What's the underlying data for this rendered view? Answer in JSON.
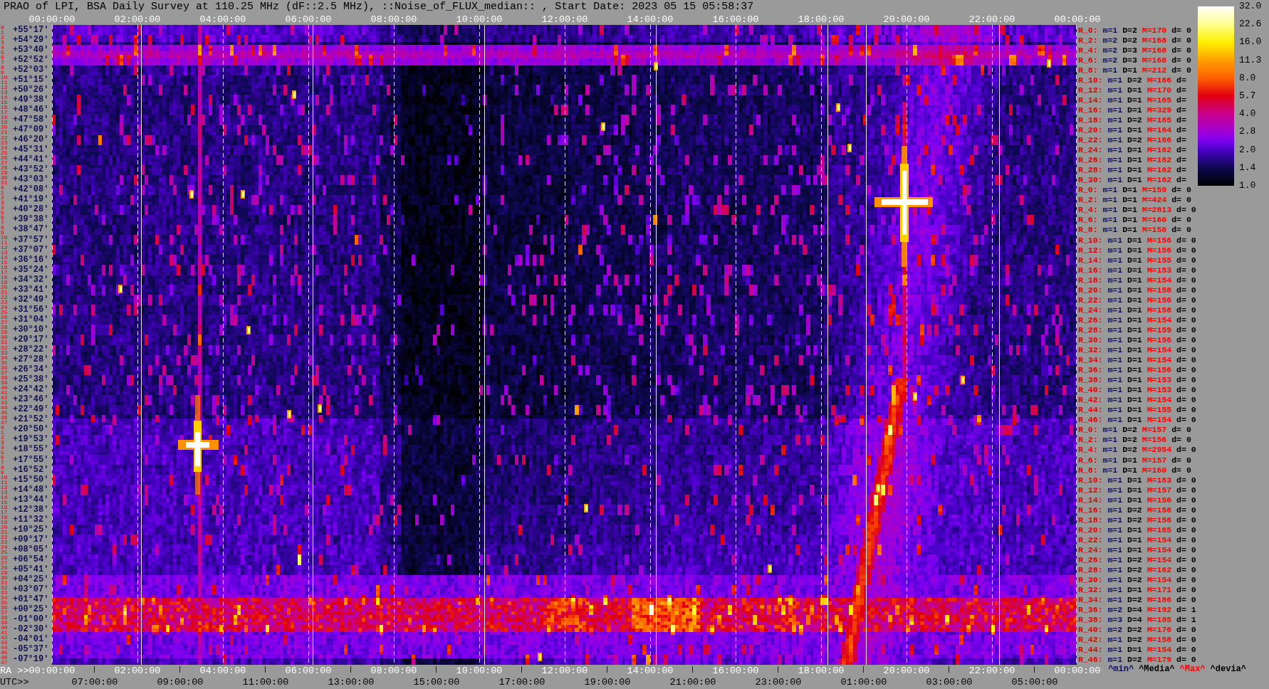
{
  "title": "PRAO of LPI, BSA Daily Survey at 110.25 MHz (dF::2.5 MHz), ::Noise_of_FLUX_median:: , Start Date: 2023 05 15 05:58:37",
  "ra_axis_top": {
    "ticks": [
      "00:00:00",
      "02:00:00",
      "04:00:00",
      "06:00:00",
      "08:00:00",
      "10:00:00",
      "12:00:00",
      "14:00:00",
      "16:00:00",
      "18:00:00",
      "20:00:00",
      "22:00:00",
      "00:00:00"
    ]
  },
  "declination_rows": [
    {
      "indices": [
        "0",
        "1"
      ],
      "label": "+55°17'"
    },
    {
      "indices": [
        "2",
        "3"
      ],
      "label": "+54°29'"
    },
    {
      "indices": [
        "4",
        "5"
      ],
      "label": "+53°40'"
    },
    {
      "indices": [
        "6",
        "7"
      ],
      "label": "+52°52'"
    },
    {
      "indices": [
        "8",
        "9"
      ],
      "label": "+52°03'"
    },
    {
      "indices": [
        "10",
        "11"
      ],
      "label": "+51°15'"
    },
    {
      "indices": [
        "12",
        "13"
      ],
      "label": "+50°26'"
    },
    {
      "indices": [
        "14",
        "15"
      ],
      "label": "+49°38'"
    },
    {
      "indices": [
        "16",
        "17"
      ],
      "label": "+48°46'"
    },
    {
      "indices": [
        "18",
        "19"
      ],
      "label": "+47°58'"
    },
    {
      "indices": [
        "20",
        "21"
      ],
      "label": "+47°09'"
    },
    {
      "indices": [
        "22",
        "23"
      ],
      "label": "+46°20'"
    },
    {
      "indices": [
        "24",
        "25"
      ],
      "label": "+45°31'"
    },
    {
      "indices": [
        "26",
        "27"
      ],
      "label": "+44°41'"
    },
    {
      "indices": [
        "28",
        "29"
      ],
      "label": "+43°52'"
    },
    {
      "indices": [
        "30",
        "31"
      ],
      "label": "+43°03'"
    },
    {
      "indices": [
        "0",
        "1"
      ],
      "label": "+42°08'"
    },
    {
      "indices": [
        "2",
        "3"
      ],
      "label": "+41°19'"
    },
    {
      "indices": [
        "4",
        "5"
      ],
      "label": "+40°28'"
    },
    {
      "indices": [
        "6",
        "7"
      ],
      "label": "+39°38'"
    },
    {
      "indices": [
        "8",
        "9"
      ],
      "label": "+38°47'"
    },
    {
      "indices": [
        "10",
        "11"
      ],
      "label": "+37°57'"
    },
    {
      "indices": [
        "12",
        "13"
      ],
      "label": "+37°07'"
    },
    {
      "indices": [
        "14",
        "15"
      ],
      "label": "+36°16'"
    },
    {
      "indices": [
        "16",
        "17"
      ],
      "label": "+35°24'"
    },
    {
      "indices": [
        "18",
        "19"
      ],
      "label": "+34°32'"
    },
    {
      "indices": [
        "20",
        "21"
      ],
      "label": "+33°41'"
    },
    {
      "indices": [
        "22",
        "23"
      ],
      "label": "+32°49'"
    },
    {
      "indices": [
        "24",
        "25"
      ],
      "label": "+31°56'"
    },
    {
      "indices": [
        "26",
        "27"
      ],
      "label": "+31°04'"
    },
    {
      "indices": [
        "28",
        "29"
      ],
      "label": "+30°10'"
    },
    {
      "indices": [
        "30",
        "31"
      ],
      "label": "+29°17'"
    },
    {
      "indices": [
        "32",
        "33"
      ],
      "label": "+28°22'"
    },
    {
      "indices": [
        "34",
        "35"
      ],
      "label": "+27°28'"
    },
    {
      "indices": [
        "36",
        "37"
      ],
      "label": "+26°34'"
    },
    {
      "indices": [
        "38",
        "39"
      ],
      "label": "+25°38'"
    },
    {
      "indices": [
        "40",
        "41"
      ],
      "label": "+24°42'"
    },
    {
      "indices": [
        "42",
        "43"
      ],
      "label": "+23°46'"
    },
    {
      "indices": [
        "44",
        "45"
      ],
      "label": "+22°49'"
    },
    {
      "indices": [
        "46",
        "47"
      ],
      "label": "+21°52'"
    },
    {
      "indices": [
        "0",
        "1"
      ],
      "label": "+20°50'"
    },
    {
      "indices": [
        "2",
        "3"
      ],
      "label": "+19°53'"
    },
    {
      "indices": [
        "4",
        "5"
      ],
      "label": "+18°55'"
    },
    {
      "indices": [
        "6",
        "7"
      ],
      "label": "+17°55'"
    },
    {
      "indices": [
        "8",
        "9"
      ],
      "label": "+16°52'"
    },
    {
      "indices": [
        "10",
        "11"
      ],
      "label": "+15°50'"
    },
    {
      "indices": [
        "12",
        "13"
      ],
      "label": "+14°48'"
    },
    {
      "indices": [
        "14",
        "15"
      ],
      "label": "+13°44'"
    },
    {
      "indices": [
        "16",
        "17"
      ],
      "label": "+12°38'"
    },
    {
      "indices": [
        "18",
        "19"
      ],
      "label": "+11°32'"
    },
    {
      "indices": [
        "20",
        "21"
      ],
      "label": "+10°25'"
    },
    {
      "indices": [
        "22",
        "23"
      ],
      "label": "+09°17'"
    },
    {
      "indices": [
        "24",
        "25"
      ],
      "label": "+08°05'"
    },
    {
      "indices": [
        "26",
        "27"
      ],
      "label": "+06°54'"
    },
    {
      "indices": [
        "28",
        "29"
      ],
      "label": "+05°41'"
    },
    {
      "indices": [
        "30",
        "31"
      ],
      "label": "+04°25'"
    },
    {
      "indices": [
        "32",
        "33"
      ],
      "label": "+03°07'"
    },
    {
      "indices": [
        "34",
        "35"
      ],
      "label": "+01°47'"
    },
    {
      "indices": [
        "36",
        "37"
      ],
      "label": "+00°25'"
    },
    {
      "indices": [
        "38",
        "39"
      ],
      "label": "-01°00'"
    },
    {
      "indices": [
        "40",
        "41"
      ],
      "label": "-02°30'"
    },
    {
      "indices": [
        "42",
        "43"
      ],
      "label": "-04°01'"
    },
    {
      "indices": [
        "44",
        "45"
      ],
      "label": "-05°37'"
    },
    {
      "indices": [
        "46",
        "47"
      ],
      "label": "-07°19'"
    }
  ],
  "row_stats": [
    {
      "label": "R_0:",
      "min": "m=1",
      "disp": "D=2",
      "max": "M=170",
      "dev": "d= 0"
    },
    {
      "label": "R_2:",
      "min": "m=2",
      "disp": "D=2",
      "max": "M=168",
      "dev": "d= 0"
    },
    {
      "label": "R_4:",
      "min": "m=2",
      "disp": "D=3",
      "max": "M=168",
      "dev": "d= 0"
    },
    {
      "label": "R_6:",
      "min": "m=2",
      "disp": "D=3",
      "max": "M=168",
      "dev": "d= 0"
    },
    {
      "label": "R_8:",
      "min": "m=1",
      "disp": "D=1",
      "max": "M=212",
      "dev": "d= 0"
    },
    {
      "label": "R_10:",
      "min": "m=1",
      "disp": "D=2",
      "max": "M=166",
      "dev": "d="
    },
    {
      "label": "R_12:",
      "min": "m=1",
      "disp": "D=1",
      "max": "M=170",
      "dev": "d="
    },
    {
      "label": "R_14:",
      "min": "m=1",
      "disp": "D=1",
      "max": "M=165",
      "dev": "d="
    },
    {
      "label": "R_16:",
      "min": "m=1",
      "disp": "D=1",
      "max": "M=329",
      "dev": "d="
    },
    {
      "label": "R_18:",
      "min": "m=1",
      "disp": "D=2",
      "max": "M=165",
      "dev": "d="
    },
    {
      "label": "R_20:",
      "min": "m=1",
      "disp": "D=1",
      "max": "M=164",
      "dev": "d="
    },
    {
      "label": "R_22:",
      "min": "m=1",
      "disp": "D=2",
      "max": "M=166",
      "dev": "d="
    },
    {
      "label": "R_24:",
      "min": "m=1",
      "disp": "D=1",
      "max": "M=162",
      "dev": "d="
    },
    {
      "label": "R_26:",
      "min": "m=1",
      "disp": "D=1",
      "max": "M=162",
      "dev": "d="
    },
    {
      "label": "R_28:",
      "min": "m=1",
      "disp": "D=1",
      "max": "M=162",
      "dev": "d="
    },
    {
      "label": "R_30:",
      "min": "m=1",
      "disp": "D=1",
      "max": "M=162",
      "dev": "d="
    },
    {
      "label": "R_0:",
      "min": "m=1",
      "disp": "D=1",
      "max": "M=159",
      "dev": "d= 0"
    },
    {
      "label": "R_2:",
      "min": "m=1",
      "disp": "D=1",
      "max": "M=424",
      "dev": "d= 0"
    },
    {
      "label": "R_4:",
      "min": "m=1",
      "disp": "D=1",
      "max": "M=2813",
      "dev": "d= 0"
    },
    {
      "label": "R_6:",
      "min": "m=1",
      "disp": "D=1",
      "max": "M=160",
      "dev": "d= 0"
    },
    {
      "label": "R_8:",
      "min": "m=1",
      "disp": "D=1",
      "max": "M=158",
      "dev": "d= 0"
    },
    {
      "label": "R_10:",
      "min": "m=1",
      "disp": "D=1",
      "max": "M=156",
      "dev": "d= 0"
    },
    {
      "label": "R_12:",
      "min": "m=1",
      "disp": "D=1",
      "max": "M=156",
      "dev": "d= 0"
    },
    {
      "label": "R_14:",
      "min": "m=1",
      "disp": "D=1",
      "max": "M=155",
      "dev": "d= 0"
    },
    {
      "label": "R_16:",
      "min": "m=1",
      "disp": "D=1",
      "max": "M=153",
      "dev": "d= 0"
    },
    {
      "label": "R_18:",
      "min": "m=1",
      "disp": "D=1",
      "max": "M=154",
      "dev": "d= 0"
    },
    {
      "label": "R_20:",
      "min": "m=1",
      "disp": "D=1",
      "max": "M=158",
      "dev": "d= 0"
    },
    {
      "label": "R_22:",
      "min": "m=1",
      "disp": "D=1",
      "max": "M=156",
      "dev": "d= 0"
    },
    {
      "label": "R_24:",
      "min": "m=1",
      "disp": "D=1",
      "max": "M=158",
      "dev": "d= 0"
    },
    {
      "label": "R_26:",
      "min": "m=1",
      "disp": "D=1",
      "max": "M=154",
      "dev": "d= 0"
    },
    {
      "label": "R_28:",
      "min": "m=1",
      "disp": "D=1",
      "max": "M=159",
      "dev": "d= 0"
    },
    {
      "label": "R_30:",
      "min": "m=1",
      "disp": "D=1",
      "max": "M=156",
      "dev": "d= 0"
    },
    {
      "label": "R_32:",
      "min": "m=1",
      "disp": "D=1",
      "max": "M=154",
      "dev": "d= 0"
    },
    {
      "label": "R_34:",
      "min": "m=1",
      "disp": "D=1",
      "max": "M=154",
      "dev": "d= 0"
    },
    {
      "label": "R_36:",
      "min": "m=1",
      "disp": "D=1",
      "max": "M=156",
      "dev": "d= 0"
    },
    {
      "label": "R_38:",
      "min": "m=1",
      "disp": "D=1",
      "max": "M=153",
      "dev": "d= 0"
    },
    {
      "label": "R_40:",
      "min": "m=1",
      "disp": "D=1",
      "max": "M=153",
      "dev": "d= 0"
    },
    {
      "label": "R_42:",
      "min": "m=1",
      "disp": "D=1",
      "max": "M=154",
      "dev": "d= 0"
    },
    {
      "label": "R_44:",
      "min": "m=1",
      "disp": "D=1",
      "max": "M=155",
      "dev": "d= 0"
    },
    {
      "label": "R_46:",
      "min": "m=1",
      "disp": "D=1",
      "max": "M=154",
      "dev": "d= 0"
    },
    {
      "label": "R_0:",
      "min": "m=1",
      "disp": "D=2",
      "max": "M=157",
      "dev": "d= 0"
    },
    {
      "label": "R_2:",
      "min": "m=1",
      "disp": "D=2",
      "max": "M=156",
      "dev": "d= 0"
    },
    {
      "label": "R_4:",
      "min": "m=1",
      "disp": "D=2",
      "max": "M=2954",
      "dev": "d= 0"
    },
    {
      "label": "R_6:",
      "min": "m=1",
      "disp": "D=1",
      "max": "M=157",
      "dev": "d= 0"
    },
    {
      "label": "R_8:",
      "min": "m=1",
      "disp": "D=1",
      "max": "M=160",
      "dev": "d= 0"
    },
    {
      "label": "R_10:",
      "min": "m=1",
      "disp": "D=1",
      "max": "M=163",
      "dev": "d= 0"
    },
    {
      "label": "R_12:",
      "min": "m=1",
      "disp": "D=1",
      "max": "M=157",
      "dev": "d= 0"
    },
    {
      "label": "R_14:",
      "min": "m=1",
      "disp": "D=1",
      "max": "M=156",
      "dev": "d= 0"
    },
    {
      "label": "R_16:",
      "min": "m=1",
      "disp": "D=2",
      "max": "M=156",
      "dev": "d= 0"
    },
    {
      "label": "R_18:",
      "min": "m=1",
      "disp": "D=2",
      "max": "M=156",
      "dev": "d= 0"
    },
    {
      "label": "R_20:",
      "min": "m=1",
      "disp": "D=1",
      "max": "M=165",
      "dev": "d= 0"
    },
    {
      "label": "R_22:",
      "min": "m=1",
      "disp": "D=1",
      "max": "M=154",
      "dev": "d= 0"
    },
    {
      "label": "R_24:",
      "min": "m=1",
      "disp": "D=1",
      "max": "M=154",
      "dev": "d= 0"
    },
    {
      "label": "R_26:",
      "min": "m=1",
      "disp": "D=2",
      "max": "M=154",
      "dev": "d= 0"
    },
    {
      "label": "R_28:",
      "min": "m=1",
      "disp": "D=2",
      "max": "M=162",
      "dev": "d= 0"
    },
    {
      "label": "R_30:",
      "min": "m=1",
      "disp": "D=2",
      "max": "M=154",
      "dev": "d= 0"
    },
    {
      "label": "R_32:",
      "min": "m=1",
      "disp": "D=1",
      "max": "M=171",
      "dev": "d= 0"
    },
    {
      "label": "R_34:",
      "min": "m=1",
      "disp": "D=2",
      "max": "M=186",
      "dev": "d= 0"
    },
    {
      "label": "R_36:",
      "min": "m=2",
      "disp": "D=4",
      "max": "M=192",
      "dev": "d= 1"
    },
    {
      "label": "R_38:",
      "min": "m=3",
      "disp": "D=4",
      "max": "M=185",
      "dev": "d= 1"
    },
    {
      "label": "R_40:",
      "min": "m=2",
      "disp": "D=2",
      "max": "M=176",
      "dev": "d= 0"
    },
    {
      "label": "R_42:",
      "min": "m=1",
      "disp": "D=2",
      "max": "M=158",
      "dev": "d= 0"
    },
    {
      "label": "R_44:",
      "min": "m=1",
      "disp": "D=1",
      "max": "M=154",
      "dev": "d= 0"
    },
    {
      "label": "R_46:",
      "min": "m=1",
      "disp": "D=2",
      "max": "M=179",
      "dev": "d= 0"
    }
  ],
  "color_scale": {
    "ticks": [
      "32.0",
      "22.6",
      "16.0",
      "11.3",
      "8.0",
      "5.7",
      "4.0",
      "2.8",
      "2.0",
      "1.4",
      "1.0"
    ]
  },
  "ra_axis_bottom": {
    "prefix": "RA >>",
    "ticks": [
      "00:00:00",
      "02:00:00",
      "04:00:00",
      "06:00:00",
      "08:00:00",
      "10:00:00",
      "12:00:00",
      "14:00:00",
      "16:00:00",
      "18:00:00",
      "20:00:00",
      "22:00:00",
      "00:00:00"
    ]
  },
  "utc_axis": {
    "prefix": "UTC>>",
    "ticks": [
      "07:00:00",
      "09:00:00",
      "11:00:00",
      "13:00:00",
      "15:00:00",
      "17:00:00",
      "19:00:00",
      "21:00:00",
      "23:00:00",
      "01:00:00",
      "03:00:00",
      "05:00:00"
    ]
  },
  "legend": [
    {
      "label": "^min^",
      "color": "#101060"
    },
    {
      "label": "^Media^",
      "color": "#000000"
    },
    {
      "label": "^Max^",
      "color": "#ff0000"
    },
    {
      "label": "^devia^",
      "color": "#000000"
    }
  ]
}
